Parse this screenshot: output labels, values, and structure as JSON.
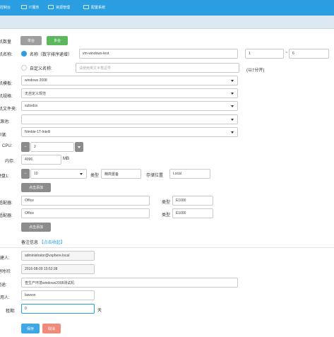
{
  "nav": {
    "items": [
      {
        "label": "控制台",
        "icon": "dashboard-icon"
      },
      {
        "label": "IT服务",
        "icon": "service-icon"
      },
      {
        "label": "资源管理",
        "icon": "resource-icon"
      },
      {
        "label": "配置系统",
        "icon": "settings-icon"
      }
    ]
  },
  "form": {
    "vm_count": {
      "label": "虚拟机数量",
      "single_label": "单台",
      "multi_label": "多台"
    },
    "name": {
      "label": "虚拟机名称:",
      "option_name_label": "名称（数字排序递增）",
      "name_value": "vm-windows-test",
      "range_start": "1",
      "range_sep": "~",
      "range_end": "6",
      "option_custom_label": "自定义名称:",
      "custom_placeholder": "请使用英文半角逗号",
      "custom_hint": "(以†分开)"
    },
    "template": {
      "label": "虚拟机模板:",
      "value": "windows 2008"
    },
    "spec": {
      "label": "虚拟机规格:",
      "value": "无自定义规范"
    },
    "folder": {
      "label": "虚拟机文件夹:",
      "value": "subsdsx"
    },
    "resource_pool": {
      "label": "资源池:",
      "value": ""
    },
    "storage": {
      "label": "存储:",
      "value": "Nimble-1T-Intelli"
    },
    "cpu": {
      "label": "CPU:",
      "value": "2"
    },
    "memory": {
      "label": "内存:",
      "value": "4096",
      "unit": "MB"
    },
    "disk": {
      "label": "硬盘1:",
      "size": "10",
      "type_label": "类型",
      "type_value": "精简置备",
      "location_label": "存储位置",
      "location_value": "Local"
    },
    "add_disk_label": "点击添加",
    "nics": [
      {
        "label": "网络适配器:",
        "value": "Office",
        "type_label": "类型",
        "type_value": "E1000"
      },
      {
        "label": "网络适配器:",
        "value": "Office",
        "type_label": "类型",
        "type_value": "E1000"
      }
    ],
    "add_nic_label": "点击添加",
    "remark": {
      "title": "备注信息",
      "toggle": "【点击收起】"
    },
    "creator": {
      "label": "创建人:",
      "value": "administrator@vsphere.local"
    },
    "created_time": {
      "label": "创建时间:",
      "value": "2016-08-09 15:52:38"
    },
    "purpose": {
      "label": "用途:",
      "value": "查生产环境windows2008测试机"
    },
    "user": {
      "label": "使用人:",
      "value": "lawson"
    },
    "lease": {
      "label": "租期:",
      "value": "0",
      "unit": "天"
    },
    "save_label": "保存",
    "cancel_label": "取消"
  },
  "colors": {
    "topbar": "#2a9ee0",
    "save": "#3fa7e6",
    "cancel": "#f08a7b",
    "multi": "#5cb85c"
  }
}
